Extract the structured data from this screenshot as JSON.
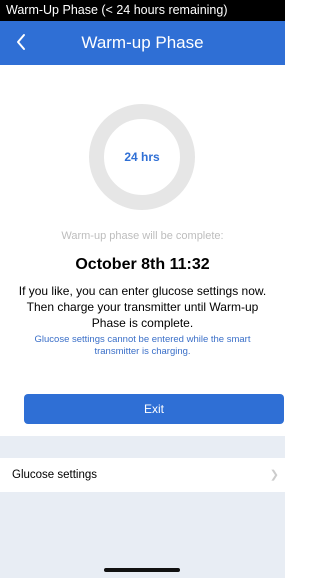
{
  "status_bar": {
    "text": "Warm-Up Phase (< 24 hours remaining)"
  },
  "nav": {
    "back_icon": "chevron-left-icon",
    "title": "Warm-up Phase"
  },
  "progress": {
    "label": "24 hrs",
    "elapsed_fraction": 0
  },
  "completion": {
    "caption": "Warm-up phase will be complete:",
    "date": "October 8th 11:32"
  },
  "instructions": "If you like, you can enter glucose settings now. Then charge your transmitter until Warm-up Phase is complete.",
  "note": "Glucose settings cannot be entered while the smart transmitter is charging.",
  "exit_button": {
    "label": "Exit"
  },
  "glucose_settings": {
    "label": "Glucose settings",
    "icon": "chevron-right-icon"
  },
  "colors": {
    "accent": "#2f6fd5",
    "ring": "#e6e6e6",
    "caption": "#bdbdbd",
    "note": "#3a6fc8",
    "section_bg": "#e8edf4"
  }
}
